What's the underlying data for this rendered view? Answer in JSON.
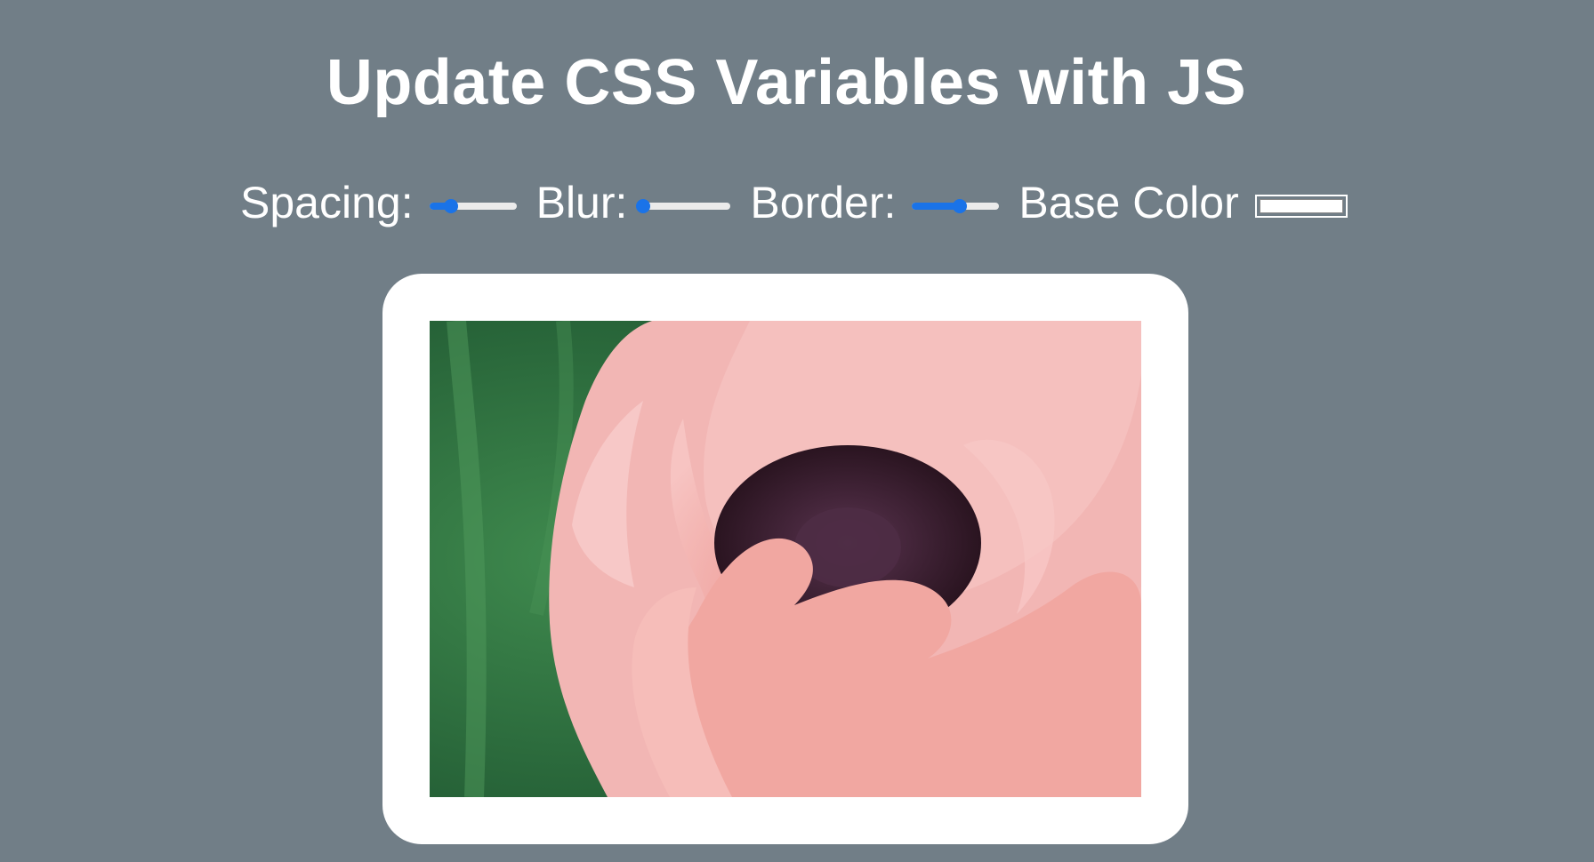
{
  "page": {
    "title": "Update CSS Variables with JS"
  },
  "controls": {
    "spacing": {
      "label": "Spacing:",
      "value": 0.25
    },
    "blur": {
      "label": "Blur:",
      "value": 0.0
    },
    "border": {
      "label": "Border:",
      "value": 0.55
    },
    "base_color": {
      "label": "Base Color",
      "value": "#ffffff"
    }
  },
  "colors": {
    "background": "#717e87",
    "accent": "#1a73e8",
    "frame": "#ffffff"
  },
  "image": {
    "subject": "pink poppy flower close-up"
  }
}
